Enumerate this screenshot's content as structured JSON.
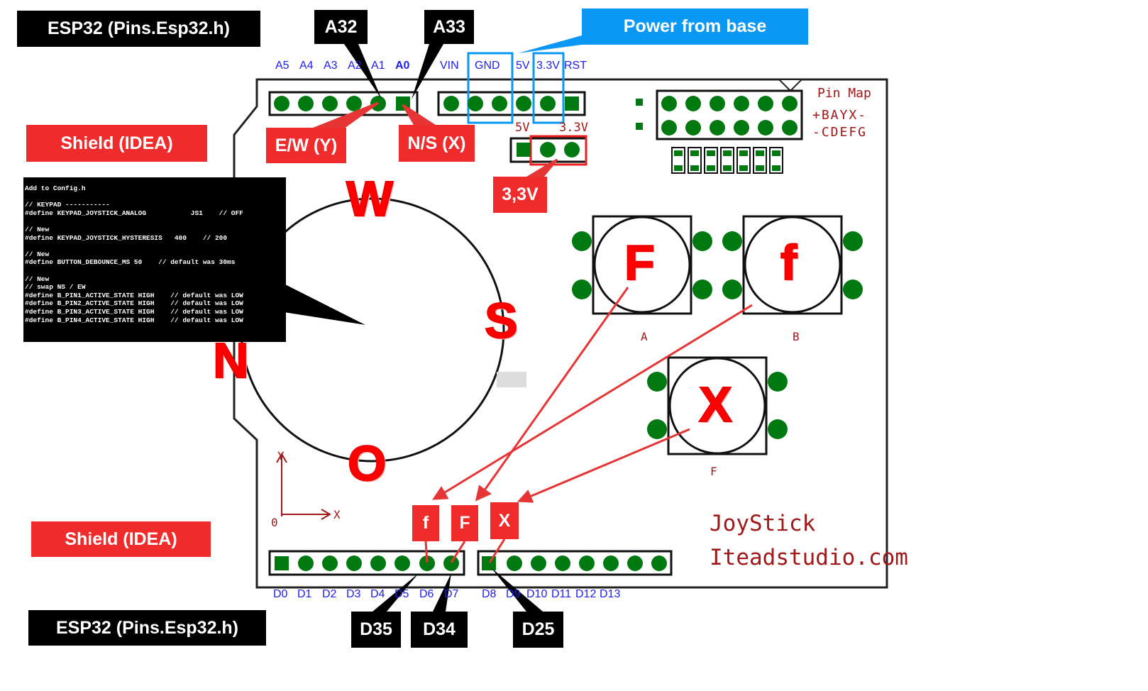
{
  "labels": {
    "esp_top": "ESP32 (Pins.Esp32.h)",
    "esp_bottom": "ESP32 (Pins.Esp32.h)",
    "a32": "A32",
    "a33": "A33",
    "power": "Power from base",
    "shield_top": "Shield (IDEA)",
    "shield_bottom": "Shield (IDEA)",
    "ew": "E/W (Y)",
    "ns": "N/S (X)",
    "v33": "3,3V",
    "f_small": "f",
    "f_big": "F",
    "x": "X",
    "d35": "D35",
    "d34": "D34",
    "d25": "D25"
  },
  "top_pins": [
    "A5",
    "A4",
    "A3",
    "A2",
    "A1",
    "A0",
    "VIN",
    "GND",
    "5V",
    "3.3V",
    "RST"
  ],
  "small_header": [
    "5V",
    "3.3V"
  ],
  "bottom_pins": [
    "D0",
    "D1",
    "D2",
    "D3",
    "D4",
    "D5",
    "D6",
    "D7",
    "D8",
    "D9",
    "D10",
    "D11",
    "D12",
    "D13"
  ],
  "code": [
    "Add to Config.h",
    "",
    "// KEYPAD -----------",
    "#define KEYPAD_JOYSTICK_ANALOG           JS1    // OFF",
    "",
    "// New",
    "#define KEYPAD_JOYSTICK_HYSTERESIS   400    // 200",
    "",
    "// New",
    "#define BUTTON_DEBOUNCE_MS 50    // default was 30ms",
    "",
    "// New",
    "// swap NS / EW",
    "#define B_PIN1_ACTIVE_STATE HIGH    // default was LOW",
    "#define B_PIN2_ACTIVE_STATE HIGH    // default was LOW",
    "#define B_PIN3_ACTIVE_STATE HIGH    // default was LOW",
    "#define B_PIN4_ACTIVE_STATE HIGH    // default was LOW"
  ],
  "compass": {
    "w": "W",
    "s": "S",
    "n": "N",
    "o": "O"
  },
  "buttons": {
    "F": "F",
    "f": "f",
    "X": "X",
    "label_a": "A",
    "label_b": "B",
    "label_f": "F"
  },
  "axis": {
    "y": "Y",
    "x": "X",
    "origin": "0"
  },
  "pinmap": {
    "title": "Pin Map",
    "row1": "+BAYX-",
    "row2": "-CDEFG"
  },
  "brand": {
    "line1": "JoyStick",
    "line2": "Iteadstudio.com"
  },
  "colors": {
    "pin_green": "#007a10",
    "label_red": "#ef2b2b",
    "highlight_blue": "#0b98f5",
    "pin_text": "#2020ee"
  }
}
